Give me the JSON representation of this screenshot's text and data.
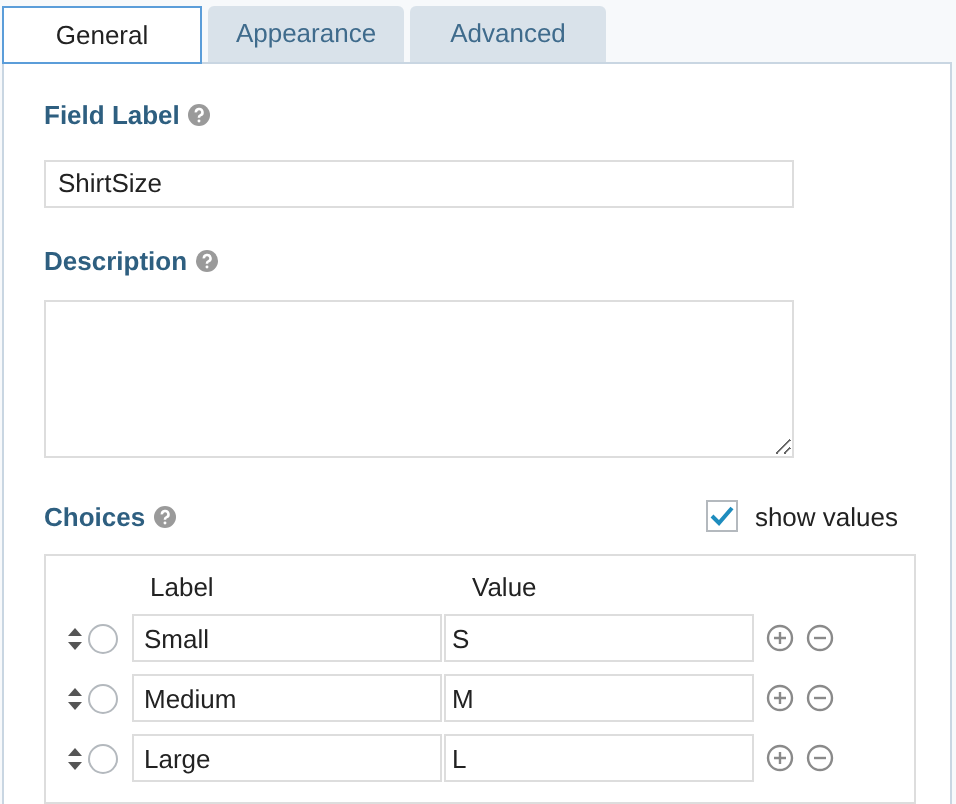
{
  "tabs": [
    {
      "label": "General",
      "selected": true
    },
    {
      "label": "Appearance",
      "selected": false
    },
    {
      "label": "Advanced",
      "selected": false
    }
  ],
  "field_label": {
    "label": "Field Label",
    "value": "ShirtSize"
  },
  "description": {
    "label": "Description"
  },
  "choices": {
    "label": "Choices",
    "show_values": {
      "label": "show values",
      "checked": true
    },
    "columns": [
      "Label",
      "Value"
    ],
    "rows": [
      {
        "label": "Small",
        "value": "S",
        "selected": false
      },
      {
        "label": "Medium",
        "value": "M",
        "selected": false
      },
      {
        "label": "Large",
        "value": "L",
        "selected": false
      }
    ]
  }
}
